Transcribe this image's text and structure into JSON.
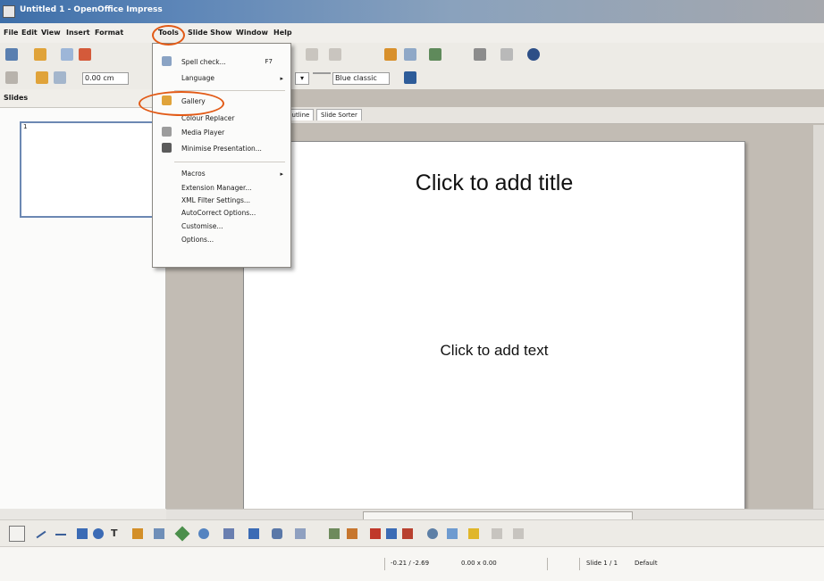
{
  "window": {
    "title": "Untitled 1 - OpenOffice Impress"
  },
  "menubar": {
    "items": [
      "File",
      "Edit",
      "View",
      "Insert",
      "Format",
      "Tools",
      "Slide Show",
      "Window",
      "Help"
    ]
  },
  "toolbar2": {
    "line_width": "0.00 cm",
    "color_box": "Blue classic"
  },
  "slides_pane": {
    "title": "Slides",
    "slide_number": "1"
  },
  "view_tabs": [
    "Outline",
    "Slide Sorter"
  ],
  "slide": {
    "title_placeholder": "Click to add title",
    "content_placeholder": "Click to add text"
  },
  "tools_menu": {
    "items": [
      {
        "label": "Spell check...",
        "shortcut": "F7",
        "icon": "spellcheck-icon"
      },
      {
        "label": "Language",
        "submenu": true
      },
      {
        "label": "Gallery",
        "icon": "gallery-icon",
        "highlighted": true
      },
      {
        "label": "Colour Replacer"
      },
      {
        "label": "Media Player",
        "icon": "media-player-icon"
      },
      {
        "label": "Minimise Presentation...",
        "icon": "minimise-icon"
      },
      {
        "label": "Macros",
        "submenu": true
      },
      {
        "label": "Extension Manager..."
      },
      {
        "label": "XML Filter Settings..."
      },
      {
        "label": "AutoCorrect Options..."
      },
      {
        "label": "Customise..."
      },
      {
        "label": "Options..."
      }
    ]
  },
  "drawing_toolbar": {
    "text_tool": "T"
  },
  "statusbar": {
    "position": "-0.21 / -2.69",
    "size": "0.00 x 0.00",
    "slide": "Slide 1 / 1",
    "layout": "Default"
  },
  "colors": {
    "annotation_circle": "#e25a16",
    "titlebar": "#3d6ea8",
    "workspace": "#c2bcb4"
  }
}
